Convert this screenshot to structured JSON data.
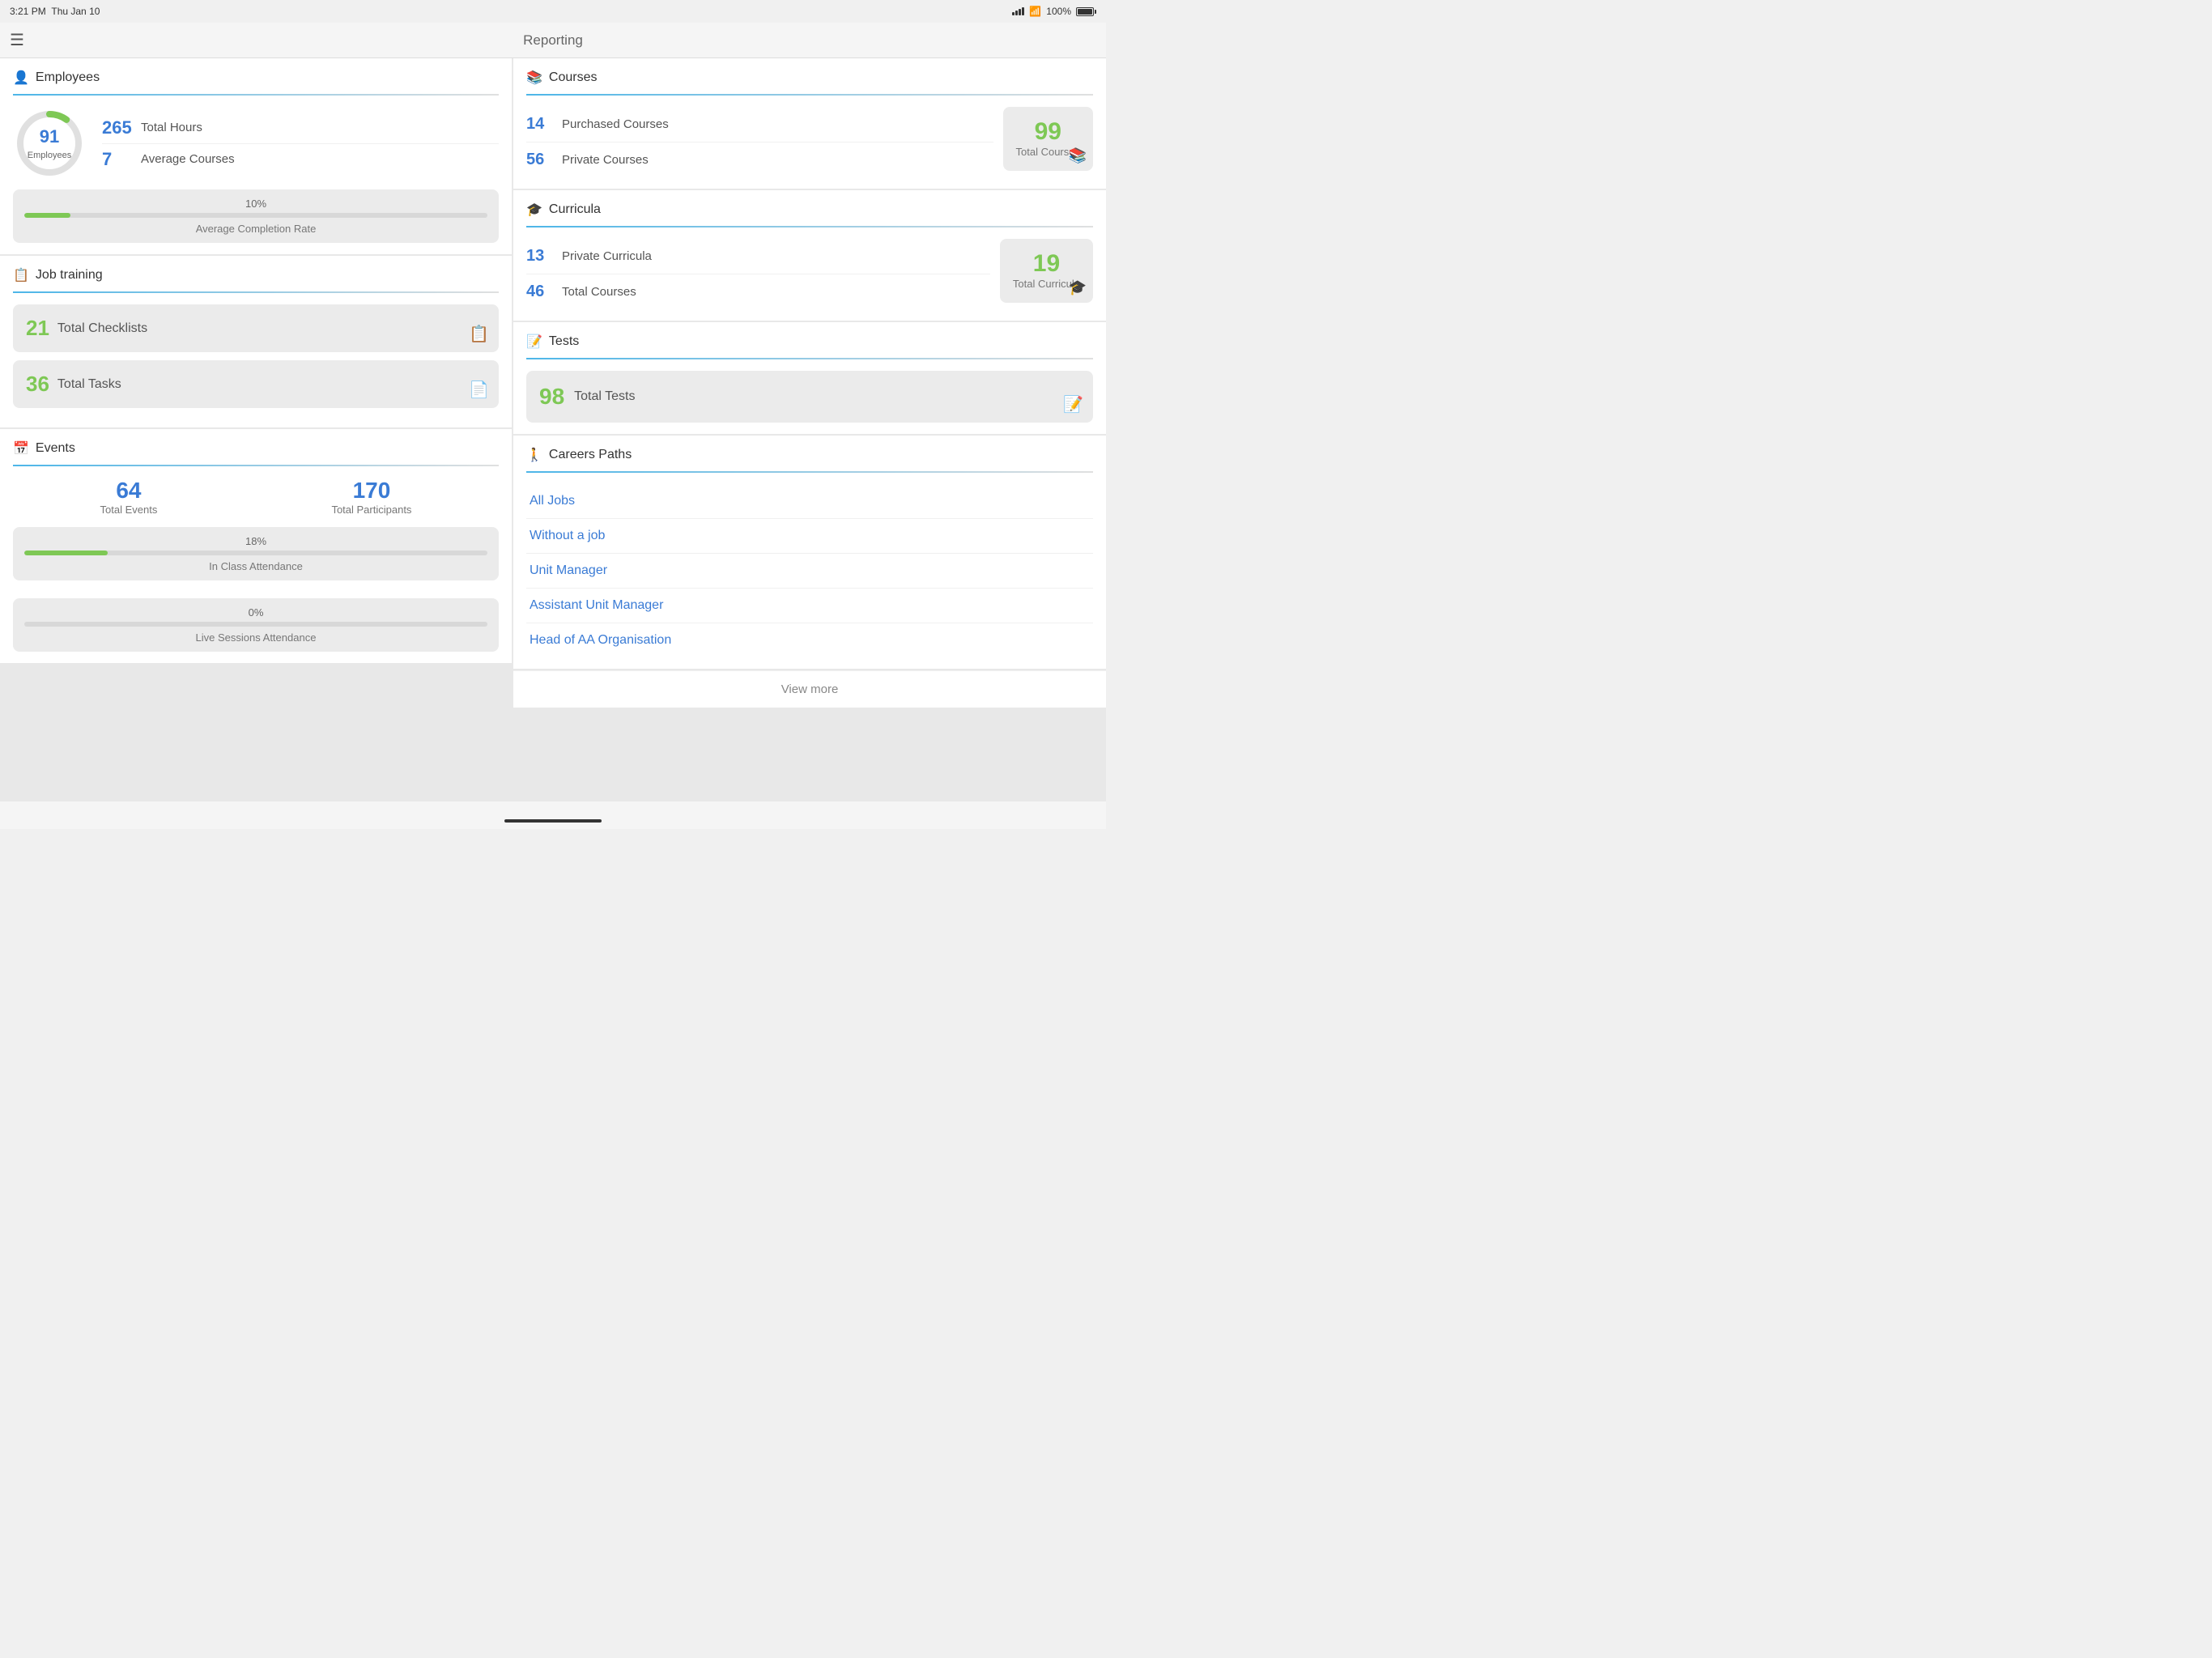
{
  "statusBar": {
    "time": "3:21 PM",
    "date": "Thu Jan 10",
    "battery": "100%"
  },
  "navBar": {
    "title": "Reporting",
    "menuIcon": "☰"
  },
  "leftPanel": {
    "employees": {
      "sectionTitle": "Employees",
      "donutNumber": "91",
      "donutLabel": "Employees",
      "stats": [
        {
          "number": "265",
          "label": "Total Hours"
        },
        {
          "number": "7",
          "label": "Average Courses"
        }
      ],
      "completion": {
        "percent": "10%",
        "label": "Average Completion Rate",
        "fillWidth": "10"
      }
    },
    "jobTraining": {
      "sectionTitle": "Job training",
      "items": [
        {
          "number": "21",
          "label": "Total Checklists"
        },
        {
          "number": "36",
          "label": "Total Tasks"
        }
      ]
    },
    "events": {
      "sectionTitle": "Events",
      "stats": [
        {
          "number": "64",
          "label": "Total Events"
        },
        {
          "number": "170",
          "label": "Total Participants"
        }
      ],
      "attendance": [
        {
          "percent": "18%",
          "label": "In Class Attendance",
          "fillWidth": "18"
        },
        {
          "percent": "0%",
          "label": "Live Sessions Attendance",
          "fillWidth": "0"
        }
      ]
    }
  },
  "rightPanel": {
    "courses": {
      "sectionTitle": "Courses",
      "items": [
        {
          "number": "14",
          "label": "Purchased Courses"
        },
        {
          "number": "56",
          "label": "Private Courses"
        }
      ],
      "total": {
        "number": "99",
        "label": "Total Courses"
      }
    },
    "curricula": {
      "sectionTitle": "Curricula",
      "items": [
        {
          "number": "13",
          "label": "Private Curricula"
        },
        {
          "number": "46",
          "label": "Total Courses"
        }
      ],
      "total": {
        "number": "19",
        "label": "Total Curricula"
      }
    },
    "tests": {
      "sectionTitle": "Tests",
      "number": "98",
      "label": "Total Tests"
    },
    "careerPaths": {
      "sectionTitle": "Careers Paths",
      "links": [
        "All Jobs",
        "Without a job",
        "Unit Manager",
        "Assistant Unit Manager",
        "Head of AA Organisation"
      ],
      "viewMore": "View more"
    }
  }
}
